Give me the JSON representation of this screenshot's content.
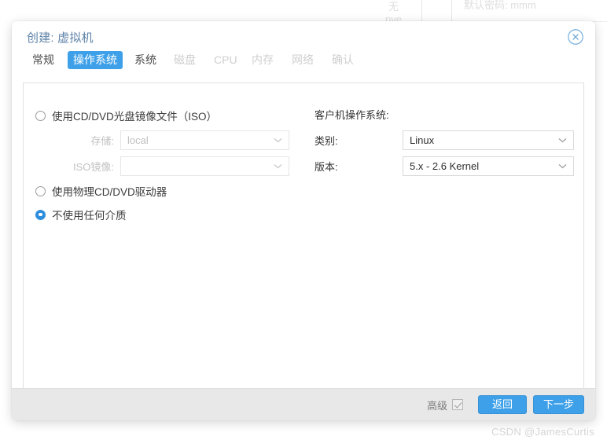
{
  "background": {
    "cell_none": "无",
    "cell_password": "默认密码: mmm",
    "cell_pve": "pve"
  },
  "dialog": {
    "title": "创建: 虚拟机",
    "close_icon": "close-circle-icon",
    "tabs": [
      {
        "label": "常规",
        "state": "normal"
      },
      {
        "label": "操作系统",
        "state": "active"
      },
      {
        "label": "系统",
        "state": "normal"
      },
      {
        "label": "磁盘",
        "state": "disabled"
      },
      {
        "label": "CPU",
        "state": "disabled"
      },
      {
        "label": "内存",
        "state": "disabled"
      },
      {
        "label": "网络",
        "state": "disabled"
      },
      {
        "label": "确认",
        "state": "disabled"
      }
    ],
    "media": {
      "options": [
        {
          "label": "使用CD/DVD光盘镜像文件（ISO）",
          "checked": false
        },
        {
          "label": "使用物理CD/DVD驱动器",
          "checked": false
        },
        {
          "label": "不使用任何介质",
          "checked": true
        }
      ],
      "storage_label": "存储:",
      "storage_value": "local",
      "iso_label": "ISO镜像:",
      "iso_value": ""
    },
    "guest_os": {
      "heading": "客户机操作系统:",
      "category_label": "类别:",
      "category_value": "Linux",
      "version_label": "版本:",
      "version_value": "5.x - 2.6 Kernel"
    },
    "footer": {
      "advanced_label": "高级",
      "advanced_checked": true,
      "back_label": "返回",
      "next_label": "下一步"
    },
    "accent_color": "#3ea0e8",
    "title_color": "#5e82a8"
  },
  "watermark": "CSDN @JamesCurtis"
}
